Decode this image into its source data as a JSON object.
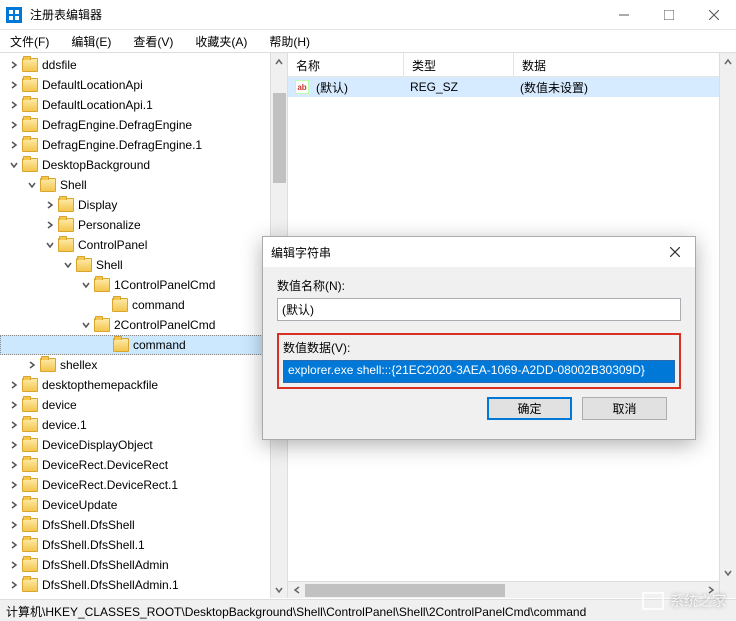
{
  "window": {
    "title": "注册表编辑器",
    "controls": {
      "min": "minimize",
      "max": "maximize",
      "close": "close"
    }
  },
  "menu": {
    "file": "文件(F)",
    "edit": "编辑(E)",
    "view": "查看(V)",
    "favorites": "收藏夹(A)",
    "help": "帮助(H)"
  },
  "tree": [
    {
      "depth": 0,
      "exp": "closed",
      "label": "ddsfile"
    },
    {
      "depth": 0,
      "exp": "closed",
      "label": "DefaultLocationApi"
    },
    {
      "depth": 0,
      "exp": "closed",
      "label": "DefaultLocationApi.1"
    },
    {
      "depth": 0,
      "exp": "closed",
      "label": "DefragEngine.DefragEngine"
    },
    {
      "depth": 0,
      "exp": "closed",
      "label": "DefragEngine.DefragEngine.1"
    },
    {
      "depth": 0,
      "exp": "open",
      "label": "DesktopBackground"
    },
    {
      "depth": 1,
      "exp": "open",
      "label": "Shell"
    },
    {
      "depth": 2,
      "exp": "closed",
      "label": "Display"
    },
    {
      "depth": 2,
      "exp": "closed",
      "label": "Personalize"
    },
    {
      "depth": 2,
      "exp": "open",
      "label": "ControlPanel"
    },
    {
      "depth": 3,
      "exp": "open",
      "label": "Shell"
    },
    {
      "depth": 4,
      "exp": "open",
      "label": "1ControlPanelCmd"
    },
    {
      "depth": 5,
      "exp": "none",
      "label": "command"
    },
    {
      "depth": 4,
      "exp": "open",
      "label": "2ControlPanelCmd"
    },
    {
      "depth": 5,
      "exp": "none",
      "label": "command",
      "selected": true
    },
    {
      "depth": 1,
      "exp": "closed",
      "label": "shellex"
    },
    {
      "depth": 0,
      "exp": "closed",
      "label": "desktopthemepackfile"
    },
    {
      "depth": 0,
      "exp": "closed",
      "label": "device"
    },
    {
      "depth": 0,
      "exp": "closed",
      "label": "device.1"
    },
    {
      "depth": 0,
      "exp": "closed",
      "label": "DeviceDisplayObject"
    },
    {
      "depth": 0,
      "exp": "closed",
      "label": "DeviceRect.DeviceRect"
    },
    {
      "depth": 0,
      "exp": "closed",
      "label": "DeviceRect.DeviceRect.1"
    },
    {
      "depth": 0,
      "exp": "closed",
      "label": "DeviceUpdate"
    },
    {
      "depth": 0,
      "exp": "closed",
      "label": "DfsShell.DfsShell"
    },
    {
      "depth": 0,
      "exp": "closed",
      "label": "DfsShell.DfsShell.1"
    },
    {
      "depth": 0,
      "exp": "closed",
      "label": "DfsShell.DfsShellAdmin"
    },
    {
      "depth": 0,
      "exp": "closed",
      "label": "DfsShell.DfsShellAdmin.1"
    }
  ],
  "list": {
    "cols": {
      "name": "名称",
      "type": "类型",
      "data": "数据"
    },
    "row": {
      "name": "(默认)",
      "type": "REG_SZ",
      "data": "(数值未设置)"
    }
  },
  "dialog": {
    "title": "编辑字符串",
    "nameLabel": "数值名称(N):",
    "nameValue": "(默认)",
    "dataLabel": "数值数据(V):",
    "dataValue": "explorer.exe shell:::{21EC2020-3AEA-1069-A2DD-08002B30309D}",
    "ok": "确定",
    "cancel": "取消"
  },
  "status": "计算机\\HKEY_CLASSES_ROOT\\DesktopBackground\\Shell\\ControlPanel\\Shell\\2ControlPanelCmd\\command",
  "watermark": "系统之家"
}
